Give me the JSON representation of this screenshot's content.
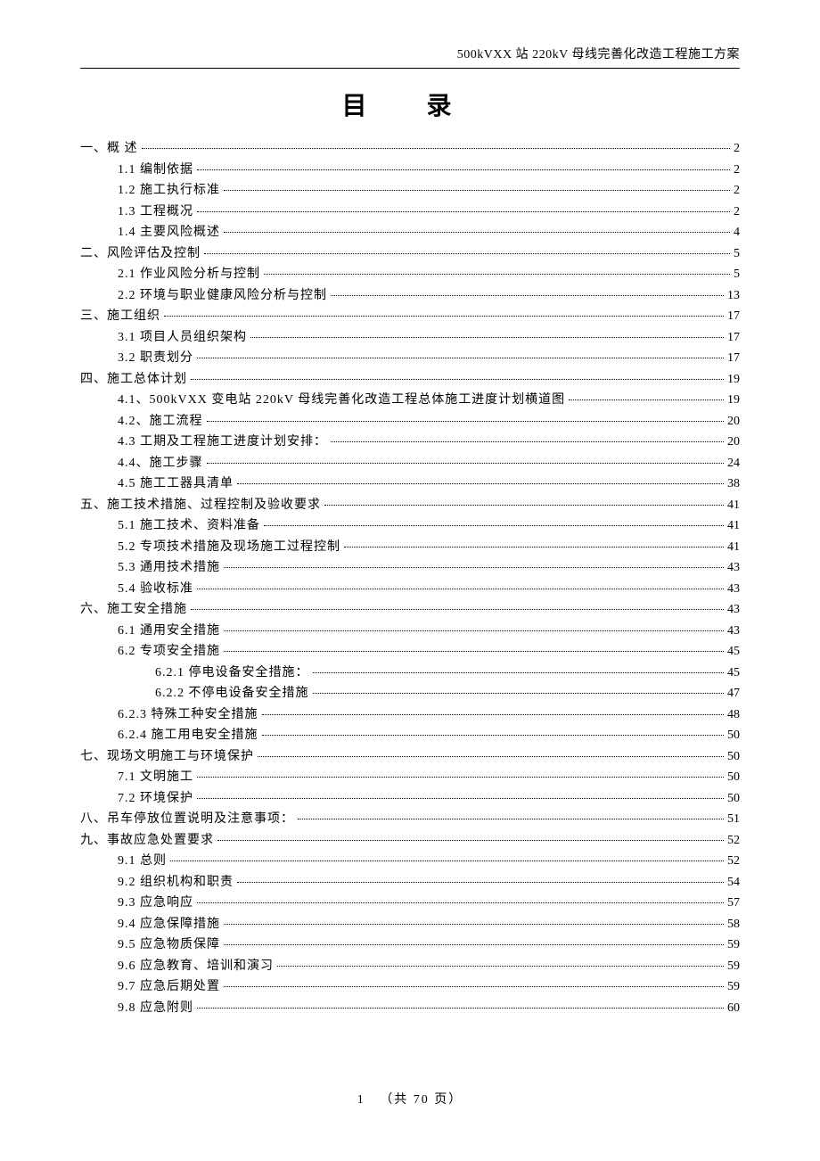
{
  "header": "500kVXX 站 220kV 母线完善化改造工程施工方案",
  "title": "目    录",
  "footer": {
    "current": "1",
    "total_label": "（共 70 页）"
  },
  "toc": [
    {
      "level": 0,
      "label": "一、概  述",
      "page": "2"
    },
    {
      "level": 1,
      "label": "1.1 编制依据",
      "page": "2"
    },
    {
      "level": 1,
      "label": "1.2 施工执行标准",
      "page": "2"
    },
    {
      "level": 1,
      "label": "1.3 工程概况",
      "page": "2"
    },
    {
      "level": 1,
      "label": "1.4 主要风险概述",
      "page": "4"
    },
    {
      "level": 0,
      "label": "二、风险评估及控制",
      "page": "5"
    },
    {
      "level": 1,
      "label": "2.1 作业风险分析与控制",
      "page": "5"
    },
    {
      "level": 1,
      "label": "2.2 环境与职业健康风险分析与控制",
      "page": "13"
    },
    {
      "level": 0,
      "label": "三、施工组织",
      "page": "17"
    },
    {
      "level": 1,
      "label": "3.1 项目人员组织架构",
      "page": "17"
    },
    {
      "level": 1,
      "label": "3.2 职责划分",
      "page": "17"
    },
    {
      "level": 0,
      "label": "四、施工总体计划",
      "page": "19"
    },
    {
      "level": 1,
      "label": "4.1、500kVXX 变电站 220kV 母线完善化改造工程总体施工进度计划横道图",
      "page": "19"
    },
    {
      "level": 1,
      "label": "4.2、施工流程",
      "page": "20"
    },
    {
      "level": 1,
      "label": "4.3 工期及工程施工进度计划安排：",
      "page": "20"
    },
    {
      "level": 1,
      "label": "4.4、施工步骤",
      "page": "24"
    },
    {
      "level": 1,
      "label": "4.5 施工工器具清单",
      "page": "38"
    },
    {
      "level": 0,
      "label": "五、施工技术措施、过程控制及验收要求",
      "page": "41"
    },
    {
      "level": 1,
      "label": "5.1 施工技术、资料准备",
      "page": "41"
    },
    {
      "level": 1,
      "label": "5.2 专项技术措施及现场施工过程控制",
      "page": "41"
    },
    {
      "level": 1,
      "label": "5.3 通用技术措施",
      "page": "43"
    },
    {
      "level": 1,
      "label": "5.4 验收标准",
      "page": "43"
    },
    {
      "level": 0,
      "label": "六、施工安全措施",
      "page": "43"
    },
    {
      "level": 1,
      "label": "6.1 通用安全措施",
      "page": "43"
    },
    {
      "level": 1,
      "label": "6.2 专项安全措施",
      "page": "45"
    },
    {
      "level": 2,
      "label": "6.2.1 停电设备安全措施：",
      "page": "45"
    },
    {
      "level": 2,
      "label": "6.2.2 不停电设备安全措施",
      "page": "47"
    },
    {
      "level": 1,
      "label": "6.2.3 特殊工种安全措施",
      "page": "48"
    },
    {
      "level": 1,
      "label": "6.2.4 施工用电安全措施",
      "page": "50"
    },
    {
      "level": 0,
      "label": "七、现场文明施工与环境保护",
      "page": "50"
    },
    {
      "level": 1,
      "label": "7.1 文明施工",
      "page": "50"
    },
    {
      "level": 1,
      "label": "7.2 环境保护",
      "page": "50"
    },
    {
      "level": 0,
      "label": "八、吊车停放位置说明及注意事项：",
      "page": "51"
    },
    {
      "level": 0,
      "label": "九、事故应急处置要求",
      "page": "52"
    },
    {
      "level": 1,
      "label": "9.1 总则",
      "page": "52"
    },
    {
      "level": 1,
      "label": "9.2 组织机构和职责",
      "page": "54"
    },
    {
      "level": 1,
      "label": "9.3 应急响应",
      "page": "57"
    },
    {
      "level": 1,
      "label": "9.4 应急保障措施",
      "page": "58"
    },
    {
      "level": 1,
      "label": "9.5 应急物质保障",
      "page": "59"
    },
    {
      "level": 1,
      "label": "9.6 应急教育、培训和演习",
      "page": "59"
    },
    {
      "level": 1,
      "label": "9.7 应急后期处置",
      "page": "59"
    },
    {
      "level": 1,
      "label": "9.8 应急附则",
      "page": "60"
    }
  ]
}
